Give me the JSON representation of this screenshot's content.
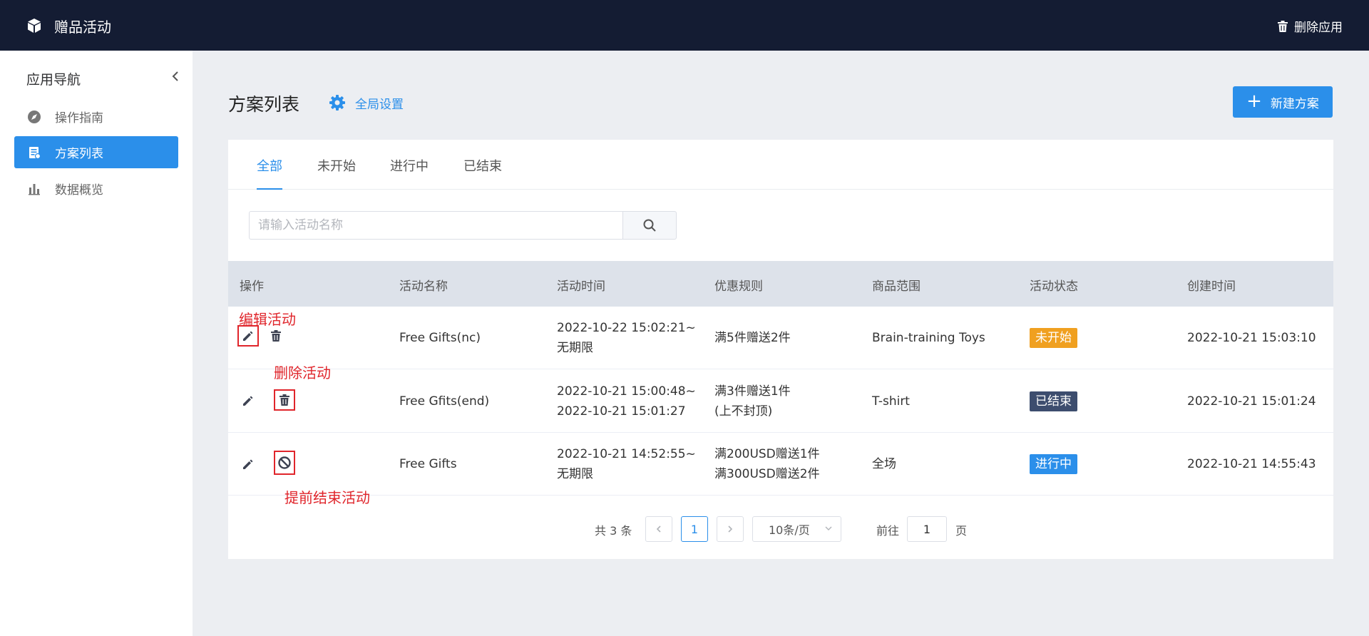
{
  "app": {
    "title": "赠品活动",
    "delete_app_label": "删除应用"
  },
  "sidebar": {
    "title": "应用导航",
    "items": [
      {
        "label": "操作指南",
        "icon": "compass-icon",
        "active": false
      },
      {
        "label": "方案列表",
        "icon": "list-icon",
        "active": true
      },
      {
        "label": "数据概览",
        "icon": "bar-chart-icon",
        "active": false
      }
    ]
  },
  "header": {
    "title": "方案列表",
    "settings_label": "全局设置",
    "new_plan_label": "新建方案"
  },
  "tabs": [
    {
      "label": "全部",
      "active": true
    },
    {
      "label": "未开始",
      "active": false
    },
    {
      "label": "进行中",
      "active": false
    },
    {
      "label": "已结束",
      "active": false
    }
  ],
  "search": {
    "placeholder": "请输入活动名称",
    "value": ""
  },
  "table": {
    "columns": [
      "操作",
      "活动名称",
      "活动时间",
      "优惠规则",
      "商品范围",
      "活动状态",
      "创建时间"
    ],
    "rows": [
      {
        "name": "Free Gifts(nc)",
        "time_start": "2022-10-22 15:02:21~",
        "time_end": "无期限",
        "rule_line1": "满5件赠送2件",
        "rule_line2": "",
        "scope": "Brain-training Toys",
        "status": "未开始",
        "created": "2022-10-21 15:03:10"
      },
      {
        "name": "Free Gfits(end)",
        "time_start": "2022-10-21 15:00:48~",
        "time_end": "2022-10-21 15:01:27",
        "rule_line1": "满3件赠送1件",
        "rule_line2": "(上不封顶)",
        "scope": "T-shirt",
        "status": "已结束",
        "created": "2022-10-21 15:01:24"
      },
      {
        "name": "Free Gifts",
        "time_start": "2022-10-21 14:52:55~",
        "time_end": "无期限",
        "rule_line1": "满200USD赠送1件",
        "rule_line2": "满300USD赠送2件",
        "scope": "全场",
        "status": "进行中",
        "created": "2022-10-21 14:55:43"
      }
    ]
  },
  "annotations": {
    "edit": "编辑活动",
    "delete": "删除活动",
    "end_early": "提前结束活动"
  },
  "pagination": {
    "total_label": "共 3 条",
    "current_page": "1",
    "page_size": "10条/页",
    "goto_label": "前往",
    "goto_value": "1",
    "page_suffix": "页"
  },
  "colors": {
    "topbar": "#141c33",
    "accent": "#2b8fea",
    "status_not_started": "#f0a020",
    "status_ended": "#3d4d6e",
    "status_in_progress": "#2b8fea",
    "annotation": "#e0252b"
  }
}
